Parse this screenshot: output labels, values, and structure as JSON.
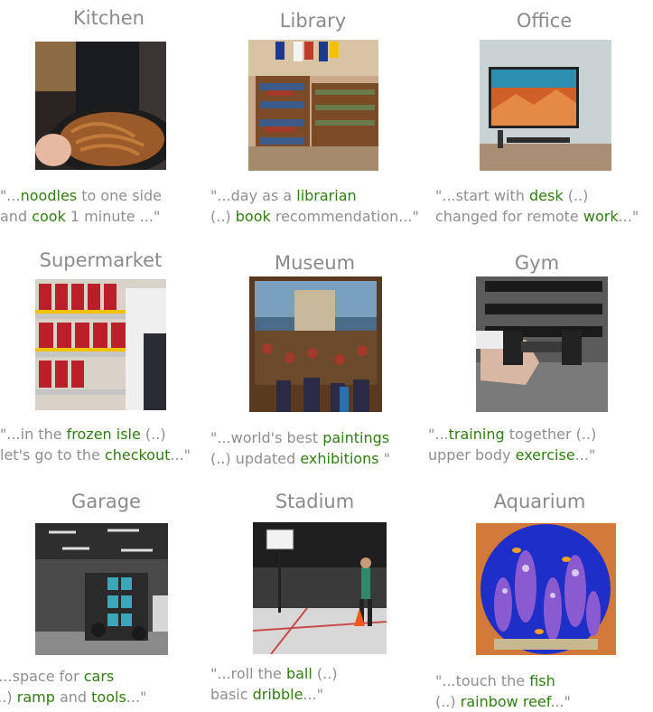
{
  "panels": [
    {
      "title": "Kitchen",
      "line1": [
        [
          "\"...",
          0
        ],
        [
          "noodles",
          1
        ],
        [
          " to one side",
          0
        ]
      ],
      "line2": [
        [
          "and ",
          0
        ],
        [
          "cook",
          1
        ],
        [
          " 1 minute ...\"",
          0
        ]
      ]
    },
    {
      "title": "Library",
      "line1": [
        [
          "\"...day as a ",
          0
        ],
        [
          "librarian",
          1
        ]
      ],
      "line2": [
        [
          "(..) ",
          0
        ],
        [
          "book",
          1
        ],
        [
          " recommendation...\"",
          0
        ]
      ]
    },
    {
      "title": "Office",
      "line1": [
        [
          "\"...start with ",
          0
        ],
        [
          "desk",
          1
        ],
        [
          " (..)",
          0
        ]
      ],
      "line2": [
        [
          "changed for remote ",
          0
        ],
        [
          "work",
          1
        ],
        [
          "...\"",
          0
        ]
      ]
    },
    {
      "title": "Supermarket",
      "line1": [
        [
          "\"...in the ",
          0
        ],
        [
          "frozen isle",
          1
        ],
        [
          " (..)",
          0
        ]
      ],
      "line2": [
        [
          "let's go to the ",
          0
        ],
        [
          "checkout",
          1
        ],
        [
          "...\"",
          0
        ]
      ]
    },
    {
      "title": "Museum",
      "line1": [
        [
          "\"...world's best ",
          0
        ],
        [
          "paintings",
          1
        ]
      ],
      "line2": [
        [
          "(..) updated ",
          0
        ],
        [
          "exhibitions",
          1
        ],
        [
          " \"",
          0
        ]
      ]
    },
    {
      "title": "Gym",
      "line1": [
        [
          "\"...",
          0
        ],
        [
          "training",
          1
        ],
        [
          " together (..)",
          0
        ]
      ],
      "line2": [
        [
          "upper body ",
          0
        ],
        [
          "exercise",
          1
        ],
        [
          "...\"",
          0
        ]
      ]
    },
    {
      "title": "Garage",
      "line1": [
        [
          "\"...space for ",
          0
        ],
        [
          "cars",
          1
        ]
      ],
      "line2": [
        [
          "(..) ",
          0
        ],
        [
          "ramp",
          1
        ],
        [
          " and ",
          0
        ],
        [
          "tools",
          1
        ],
        [
          "...\"",
          0
        ]
      ]
    },
    {
      "title": "Stadium",
      "line1": [
        [
          "\"...roll the ",
          0
        ],
        [
          "ball",
          1
        ],
        [
          " (..)",
          0
        ]
      ],
      "line2": [
        [
          "basic ",
          0
        ],
        [
          "dribble",
          1
        ],
        [
          "...\"",
          0
        ]
      ]
    },
    {
      "title": "Aquarium",
      "line1": [
        [
          "\"...touch the ",
          0
        ],
        [
          "fish",
          1
        ]
      ],
      "line2": [
        [
          "(..) ",
          0
        ],
        [
          "rainbow reef",
          1
        ],
        [
          "...\"",
          0
        ]
      ]
    }
  ],
  "colors": {
    "title": "#8a8a8a",
    "caption": "#8f8f8f",
    "keyword": "#2f7d10"
  }
}
